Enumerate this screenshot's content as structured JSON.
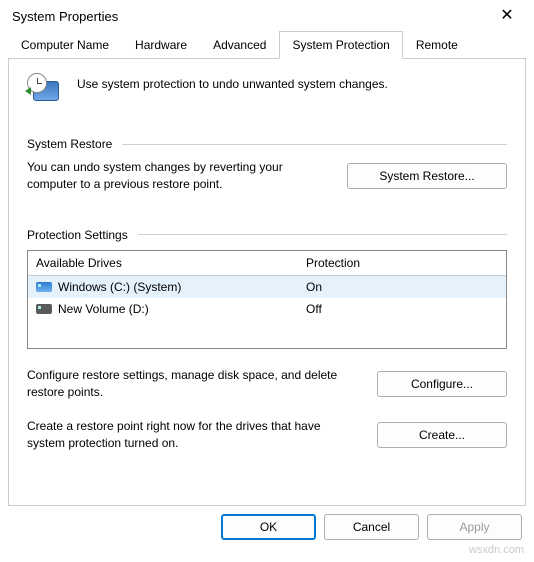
{
  "window": {
    "title": "System Properties"
  },
  "tabs": {
    "items": [
      {
        "label": "Computer Name"
      },
      {
        "label": "Hardware"
      },
      {
        "label": "Advanced"
      },
      {
        "label": "System Protection"
      },
      {
        "label": "Remote"
      }
    ],
    "active_index": 3
  },
  "intro": {
    "text": "Use system protection to undo unwanted system changes."
  },
  "system_restore": {
    "heading": "System Restore",
    "description": "You can undo system changes by reverting your computer to a previous restore point.",
    "button": "System Restore..."
  },
  "protection": {
    "heading": "Protection Settings",
    "columns": {
      "drives": "Available Drives",
      "protection": "Protection"
    },
    "rows": [
      {
        "name": "Windows (C:) (System)",
        "status": "On",
        "type": "sys",
        "selected": true
      },
      {
        "name": "New Volume (D:)",
        "status": "Off",
        "type": "hdd",
        "selected": false
      }
    ],
    "configure_text": "Configure restore settings, manage disk space, and delete restore points.",
    "configure_button": "Configure...",
    "create_text": "Create a restore point right now for the drives that have system protection turned on.",
    "create_button": "Create..."
  },
  "dialog_buttons": {
    "ok": "OK",
    "cancel": "Cancel",
    "apply": "Apply"
  },
  "watermark": "wsxdn.com"
}
